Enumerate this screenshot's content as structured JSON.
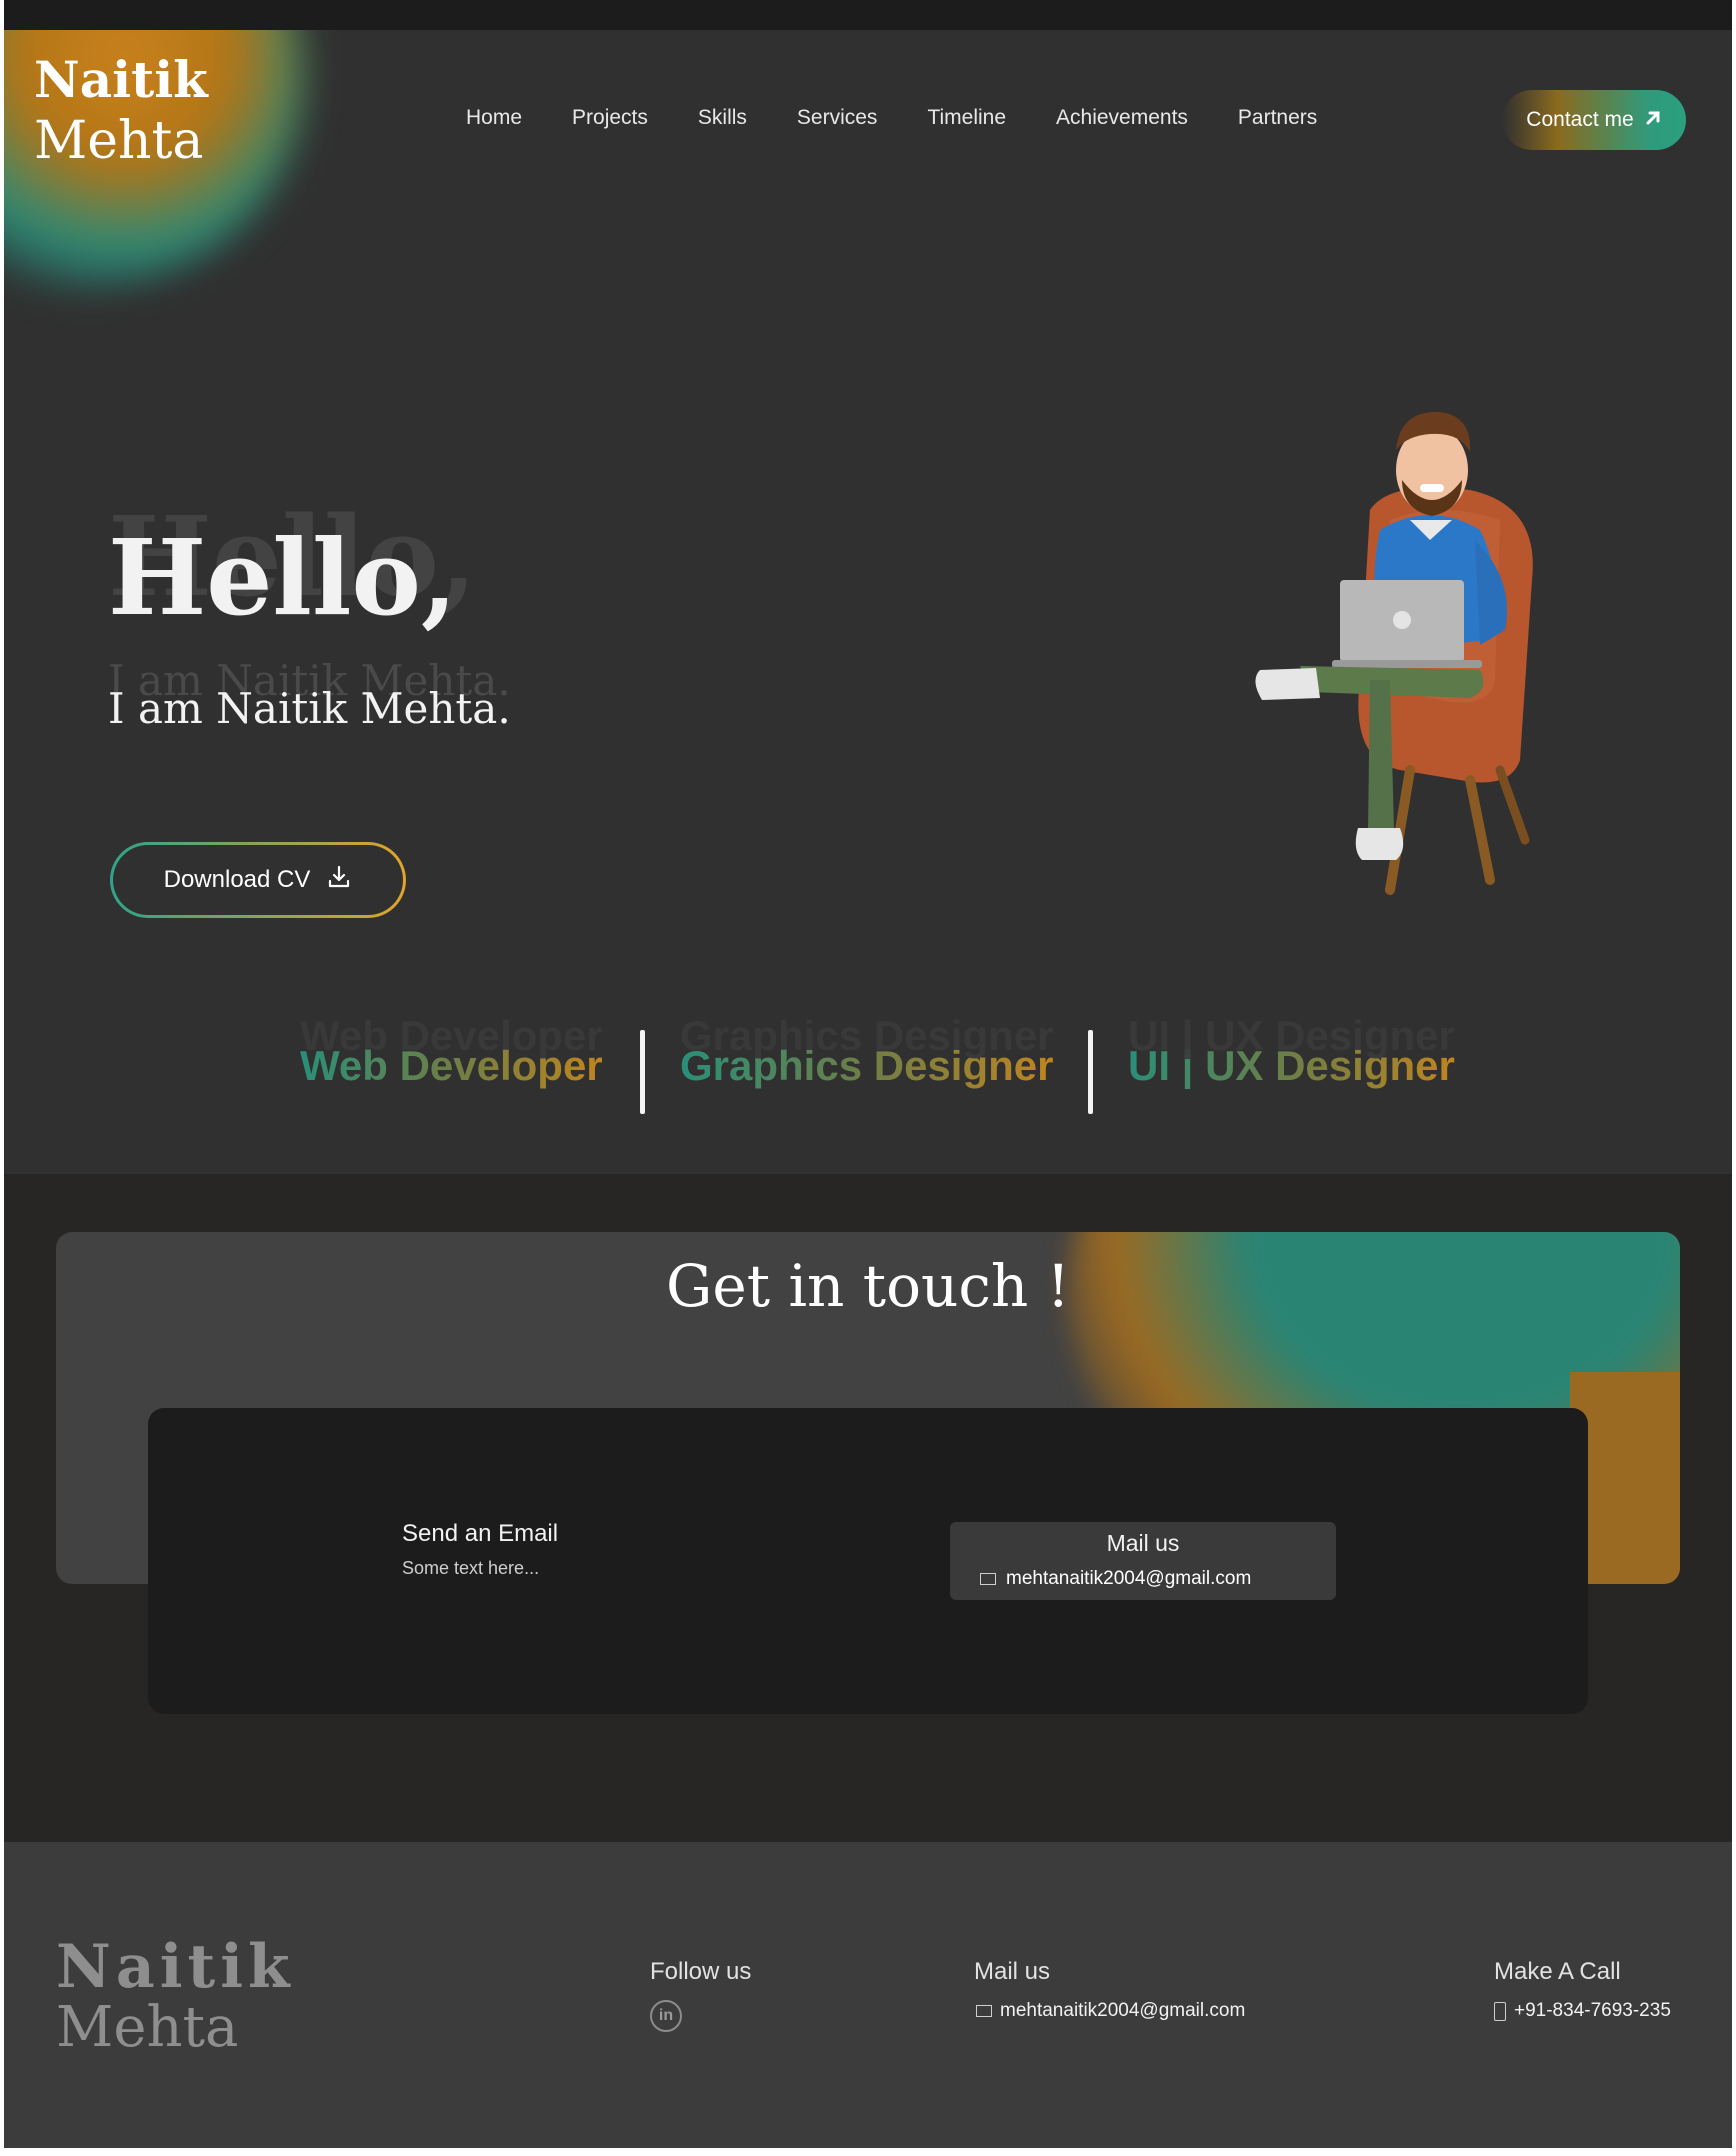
{
  "brand": {
    "first": "Naitik",
    "last": "Mehta"
  },
  "nav": {
    "items": [
      "Home",
      "Projects",
      "Skills",
      "Services",
      "Timeline",
      "Achievements",
      "Partners"
    ],
    "contact_label": "Contact me",
    "contact_icon": "arrow-up-right-icon"
  },
  "hero": {
    "greeting": "Hello,",
    "intro": "I am Naitik Mehta.",
    "download_label": "Download CV",
    "download_icon": "download-icon",
    "roles": [
      "Web Developer",
      "Graphics Designer",
      "UI | UX Designer"
    ]
  },
  "contact": {
    "title": "Get in touch !",
    "send_title": "Send an Email",
    "send_sub": "Some text here...",
    "mail_title": "Mail us",
    "mail_value": "mehtanaitik2004@gmail.com"
  },
  "footer": {
    "follow_title": "Follow us",
    "linkedin_glyph": "in",
    "mail_title": "Mail us",
    "mail_value": "mehtanaitik2004@gmail.com",
    "call_title": "Make A Call",
    "call_value": "+91-834-7693-235"
  },
  "colors": {
    "accent_teal": "#2a8f78",
    "accent_gold": "#c1851d",
    "background": "#303030"
  }
}
